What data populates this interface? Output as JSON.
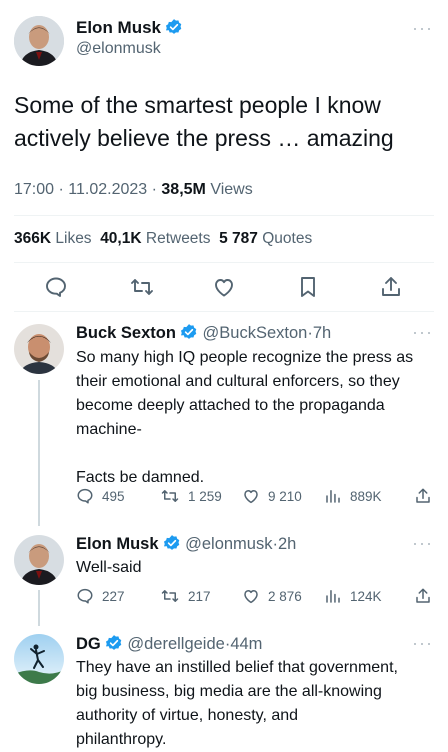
{
  "main_tweet": {
    "author_name": "Elon Musk",
    "author_handle": "@elonmusk",
    "text_line1": "Some of the smartest people I know",
    "text_line2": "actively believe the press … amazing",
    "time": "17:00",
    "date": "11.02.2023",
    "views_count": "38,5M",
    "views_label": "Views",
    "likes_count": "366K",
    "likes_label": "Likes",
    "retweets_count": "40,1K",
    "retweets_label": "Retweets",
    "quotes_count": "5 787",
    "quotes_label": "Quotes",
    "more": "···"
  },
  "replies": [
    {
      "name": "Buck Sexton",
      "handle": "@BuckSexton",
      "age": "7h",
      "lines": [
        "So many high IQ people recognize the press as",
        "their emotional and cultural enforcers, so they",
        "become deeply attached to the propaganda",
        "machine-",
        "",
        "Facts be damned."
      ],
      "replies": "495",
      "retweets": "1 259",
      "likes": "9 210",
      "views": "889K",
      "more": "···"
    },
    {
      "name": "Elon Musk",
      "handle": "@elonmusk",
      "age": "2h",
      "lines": [
        "Well-said"
      ],
      "replies": "227",
      "retweets": "217",
      "likes": "2 876",
      "views": "124K",
      "more": "···"
    },
    {
      "name": "DG",
      "handle": "@derellgeide",
      "age": "44m",
      "lines": [
        "They have an instilled belief that government,",
        "big business, big media are the all-knowing",
        "authority of virtue, honesty, and",
        "philanthropy."
      ],
      "more": "···"
    }
  ],
  "separator": "·",
  "colors": {
    "verified": "#1d9bf0",
    "muted": "#536471",
    "text": "#0f1419",
    "divider": "#eff3f4"
  }
}
